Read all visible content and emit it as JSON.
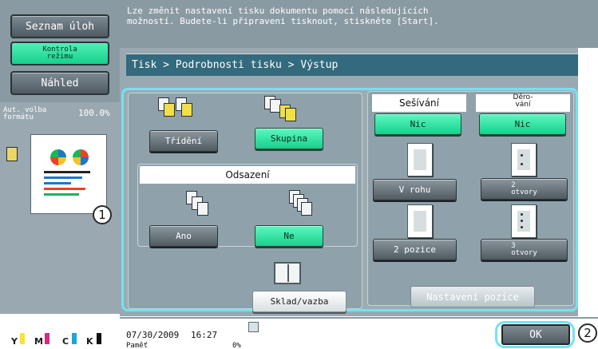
{
  "left_panel": {
    "job_list_button": "Seznam úloh",
    "check_mode_button": "Kontrola\nrežimu",
    "preview_button": "Náhled",
    "auto_label": "Aut. volba\nformátu",
    "zoom_value": "100.0%",
    "callout_1": "1"
  },
  "message": {
    "line1": "Lze změnit nastavení tisku dokumentu pomocí následujících",
    "line2": "možností. Budete-li připraveni tisknout, stiskněte [Start]."
  },
  "breadcrumb": "Tisk > Podrobnosti tisku > Výstup",
  "sorting": {
    "sort_button": "Třídění",
    "group_button": "Skupina"
  },
  "offset": {
    "title": "Odsazení",
    "yes_button": "Ano",
    "no_button": "Ne"
  },
  "booklet": {
    "button": "Sklad/vazba"
  },
  "stapling": {
    "title": "Sešívání",
    "none_button": "Nic",
    "corner_button": "V rohu",
    "two_position_button": "2 pozice"
  },
  "punching": {
    "title": "Děro-\nvání",
    "none_button": "Nic",
    "two_holes_button": "2\notvory",
    "three_holes_button": "3\notvory"
  },
  "position_setting_button": "Nastavení pozice",
  "status": {
    "date": "07/30/2009",
    "time": "16:27",
    "memory_label": "Paměť",
    "memory_value": "0%",
    "callout_2": "2"
  },
  "ok_button": "OK",
  "toner": {
    "y": "Y",
    "m": "M",
    "c": "C",
    "k": "K"
  },
  "colors": {
    "accent_cyan": "#74e2f1",
    "selected_green": "#16d18e",
    "panel_gray": "#8a9aa3"
  }
}
